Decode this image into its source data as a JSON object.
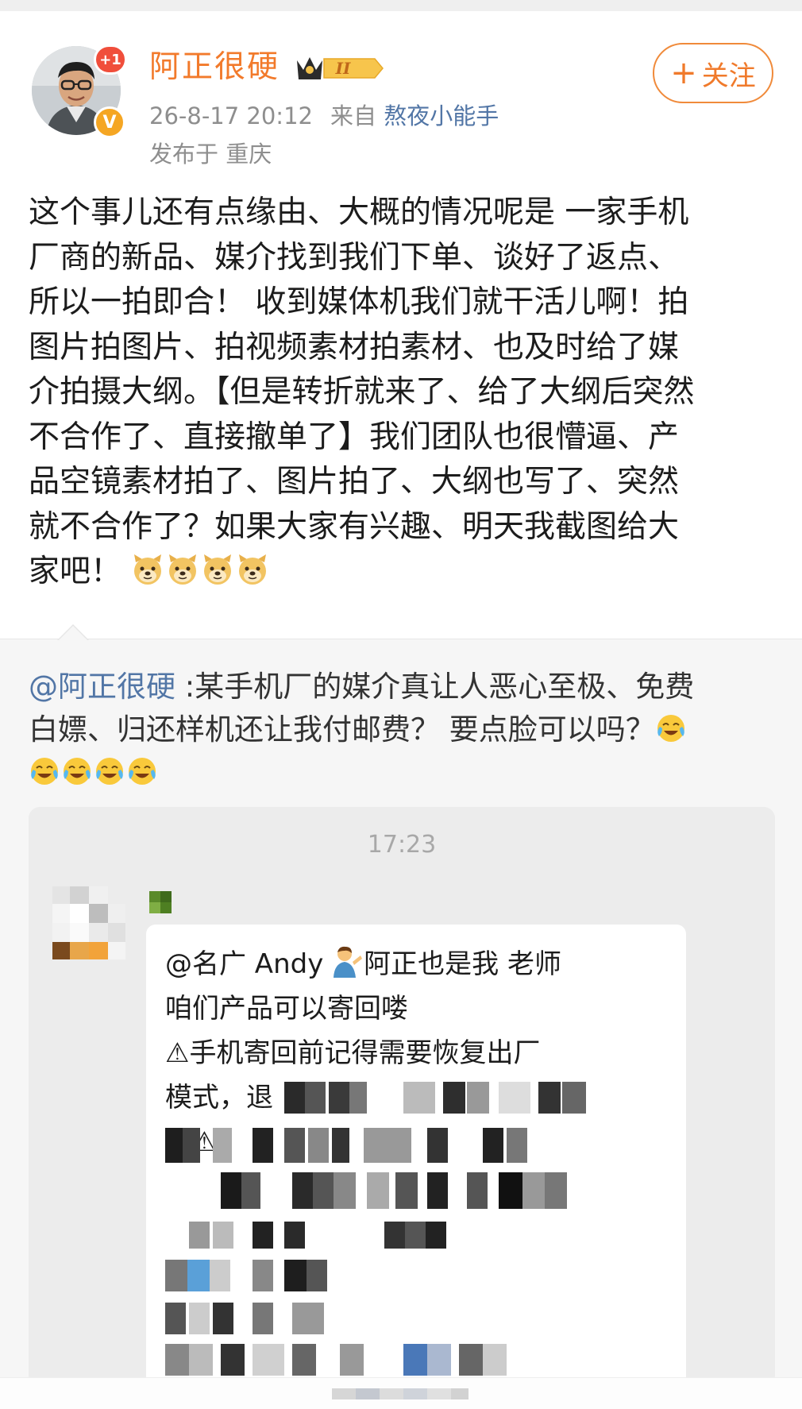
{
  "header": {
    "username": "阿正很硬",
    "level_badge": "II",
    "plus_badge": "+1",
    "timestamp": "26-8-17 20:12",
    "source_prefix": "来自",
    "source_name": "熬夜小能手",
    "location": "发布于 重庆",
    "follow_label": "关注",
    "follow_plus": "+"
  },
  "post": {
    "lines": [
      "这个事儿还有点缘由、大概的情况呢是 一家手机",
      "厂商的新品、媒介找到我们下单、谈好了返点、",
      "所以一拍即合！ 收到媒体机我们就干活儿啊！拍",
      "图片拍图片、拍视频素材拍素材、也及时给了媒",
      "介拍摄大纲。【但是转折就来了、给了大纲后突然",
      "不合作了、直接撤单了】我们团队也很懵逼、产",
      "品空镜素材拍了、图片拍了、大纲也写了、突然",
      "就不合作了？如果大家有兴趣、明天我截图给大"
    ],
    "last_line": "家吧！",
    "emoji": "doge",
    "emoji_count": 4
  },
  "repost": {
    "mention": "@阿正很硬",
    "line1_text": " :某手机厂的媒介真让人恶心至极、免费",
    "line2_text": "白嫖、归还样机还让我付邮费？ 要点脸可以吗？",
    "emoji": "laugh-cry",
    "emoji_count": 5
  },
  "chat": {
    "time": "17:23",
    "lines": [
      "@名广 Andy ",
      "阿正也是我 老师",
      "咱们产品可以寄回喽",
      "⚠手机寄回前记得需要恢复出厂",
      "模式，退",
      "回⚠"
    ]
  },
  "colors": {
    "accent_orange": "#f27a2b",
    "link_blue": "#5276a6",
    "meta_gray": "#8e8e8e",
    "repost_bg": "#f6f6f6",
    "chat_bg": "#ececec"
  }
}
